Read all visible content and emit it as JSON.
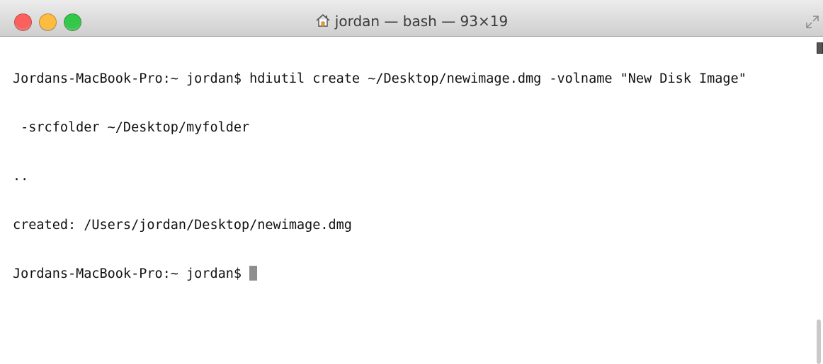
{
  "window": {
    "title": "jordan — bash — 93×19",
    "title_icon": "home-icon",
    "traffic_lights": {
      "close_color": "#fc605c",
      "minimize_color": "#fdbc40",
      "zoom_color": "#34c84a"
    }
  },
  "terminal": {
    "lines": [
      "Jordans-MacBook-Pro:~ jordan$ hdiutil create ~/Desktop/newimage.dmg -volname \"New Disk Image\"",
      " -srcfolder ~/Desktop/myfolder",
      "..",
      "created: /Users/jordan/Desktop/newimage.dmg"
    ],
    "prompt": "Jordans-MacBook-Pro:~ jordan$ "
  }
}
